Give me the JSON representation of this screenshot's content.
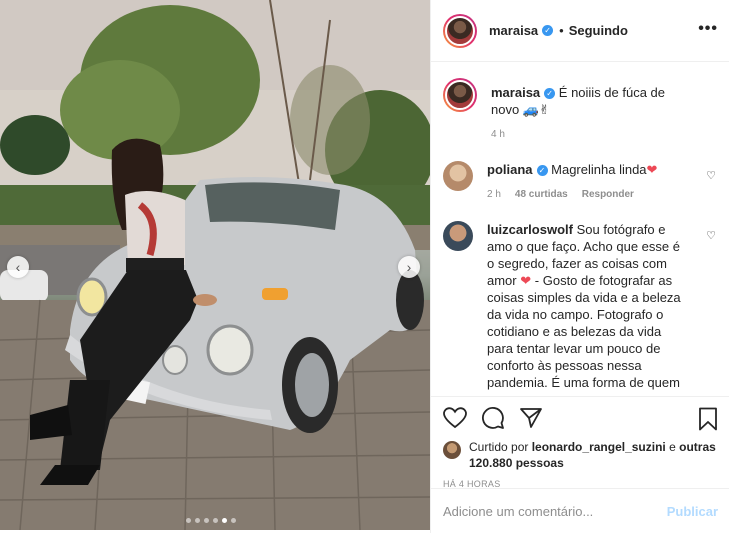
{
  "post": {
    "author": "maraisa",
    "follow_separator": "•",
    "follow_status": "Seguindo",
    "more": "•••",
    "carousel": {
      "dots_total": 6,
      "active_dot": 4
    }
  },
  "caption": {
    "username": "maraisa",
    "text": "É noiiis de fúca de novo",
    "emojis": "🚙✌",
    "time": "4 h"
  },
  "comments": [
    {
      "username": "poliana",
      "verified": true,
      "text": "Magrelinha linda",
      "emoji": "❤",
      "time": "2 h",
      "likes": "48 curtidas",
      "reply": "Responder"
    },
    {
      "username": "luizcarloswolf",
      "verified": false,
      "text_before": "Sou fotógrafo e amo o que faço. Acho que esse é o segredo, fazer as coisas com amor",
      "emoji": "❤",
      "text_after": "- Gosto de fotografar as coisas simples da vida e a beleza da vida no campo. Fotografo o cotidiano e as belezas da vida para tentar levar um pouco de conforto às pessoas nessa pandemia. É uma forma de quem"
    }
  ],
  "likes": {
    "prefix": "Curtido por",
    "user": "leonardo_rangel_suzini",
    "joiner": "e",
    "others": "outras 120.880 pessoas"
  },
  "timestamp": "HÁ 4 HORAS",
  "comment_box": {
    "placeholder": "Adicione um comentário...",
    "publish_label": "Publicar"
  },
  "colors": {
    "verified": "#3897f0",
    "heart": "#ed4956",
    "publish_disabled": "#b3dbff",
    "muted": "#8e8e8e"
  }
}
